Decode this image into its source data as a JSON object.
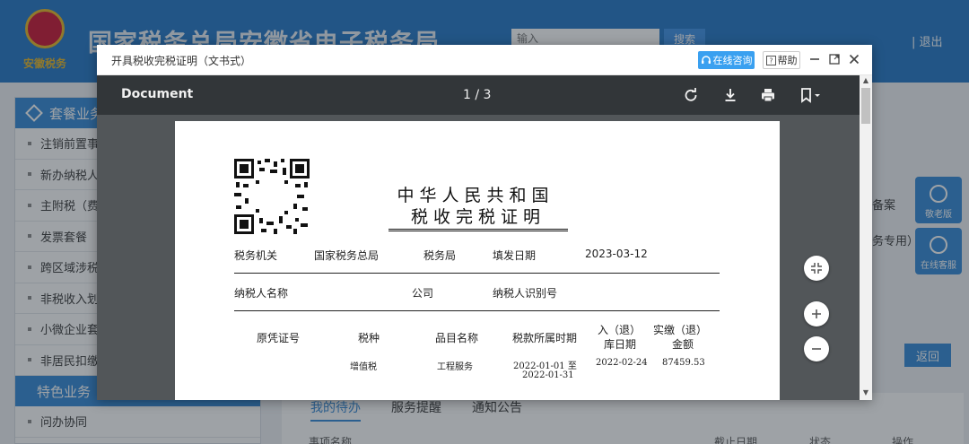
{
  "background": {
    "site_title": "国家税务总局安徽省电子税务局",
    "emblem_text": "安徽税务",
    "search_placeholder": "输入",
    "search_button": "搜索",
    "logout": "退出",
    "sidebar": {
      "section1": "套餐业务",
      "items": [
        "注销前置事",
        "新办纳税人",
        "主附税（费",
        "发票套餐",
        "跨区域涉税",
        "非税收入划",
        "小微企业套",
        "非居民扣缴"
      ],
      "section2": "特色业务",
      "items2": [
        "问办协同"
      ]
    },
    "right_text1": "备案",
    "right_text2": "务专用）",
    "float_buttons": [
      "敬老版",
      "在线客服"
    ],
    "return_button": "返回",
    "tabs": [
      "我的待办",
      "服务提醒",
      "通知公告"
    ],
    "table_headers": [
      "事项名称",
      "截止日期",
      "状态",
      "操作"
    ]
  },
  "modal": {
    "title": "开具税收完税证明（文书式）",
    "consult_button": "在线咨询",
    "help_button": "帮助"
  },
  "viewer": {
    "doc_title": "Document",
    "page_current": "1",
    "page_total": "3",
    "page_sep": " / "
  },
  "document": {
    "title_line1": "中华人民共和国",
    "title_line2": "税收完税证明",
    "tax_office_label": "税务机关",
    "tax_office_value": "国家税务总局",
    "tax_office_suffix": "税务局",
    "fill_date_label": "填发日期",
    "fill_date_value": "2023-03-12",
    "taxpayer_name_label": "纳税人名称",
    "taxpayer_name_suffix": "公司",
    "taxpayer_id_label": "纳税人识别号",
    "columns": {
      "voucher_no": "原凭证号",
      "tax_type": "税种",
      "item_name": "品目名称",
      "period": "税款所属时期",
      "date_l1": "入（退）",
      "date_l2": "库日期",
      "amount_l1": "实缴（退）",
      "amount_l2": "金额"
    },
    "row1": {
      "tax_type": "增值税",
      "item_name": "工程服务",
      "period_l1": "2022-01-01 至",
      "period_l2": "2022-01-31",
      "date": "2022-02-24",
      "amount": "87459.53"
    }
  }
}
